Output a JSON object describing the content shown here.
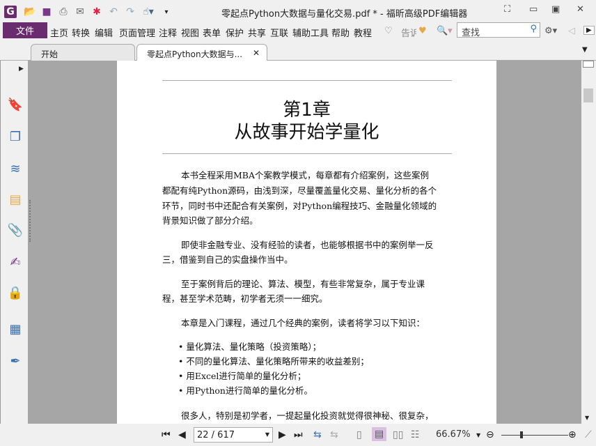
{
  "window": {
    "title": "零起点Python大数据与量化交易.pdf * - 福昕高级PDF编辑器"
  },
  "menu": {
    "file": "文件",
    "items": [
      "主页",
      "转换",
      "编辑",
      "页面管理",
      "注释",
      "视图",
      "表单",
      "保护",
      "共享",
      "互联",
      "辅助工具",
      "帮助",
      "教程"
    ],
    "tell": "告诉",
    "search_placeholder": "查找"
  },
  "tabs": [
    {
      "label": "开始"
    },
    {
      "label": "零起点Python大数据与..."
    }
  ],
  "document": {
    "chapter": "第1章",
    "title": "从故事开始学量化",
    "paragraphs": [
      [
        "本书全程采用MBA个案教学模式，每章都有介绍案例，这些案例",
        "都配有纯Python源码，由浅到深，尽量覆盖量化交易、量化分析的各个",
        "环节，同时书中还配合有关案例，对Python编程技巧、金融量化领域的",
        "背景知识做了部分介绍。"
      ],
      [
        "即使非金融专业、没有经验的读者，也能够根据书中的案例举一反",
        "三，借鉴到自己的实盘操作当中。"
      ],
      [
        "至于案例背后的理论、算法、模型，有些非常复杂，属于专业课",
        "程，甚至学术范畴，初学者无须一一细究。"
      ],
      [
        "本章是入门课程，通过几个经典的案例，读者将学习以下知识："
      ]
    ],
    "bullets": [
      "量化算法、量化策略（投资策略）；",
      "不同的量化算法、量化策略所带来的收益差别；",
      "用Excel进行简单的量化分析；",
      "用Python进行简单的量化分析。"
    ],
    "last_line": "很多人，特别是初学者，一提起量化投资就觉得很神秘、很复杂，"
  },
  "statusbar": {
    "page": "22 / 617",
    "zoom": "66.67%",
    "zoom_slider_fraction": 0.5
  },
  "colors": {
    "accent": "#6b2c6f"
  }
}
